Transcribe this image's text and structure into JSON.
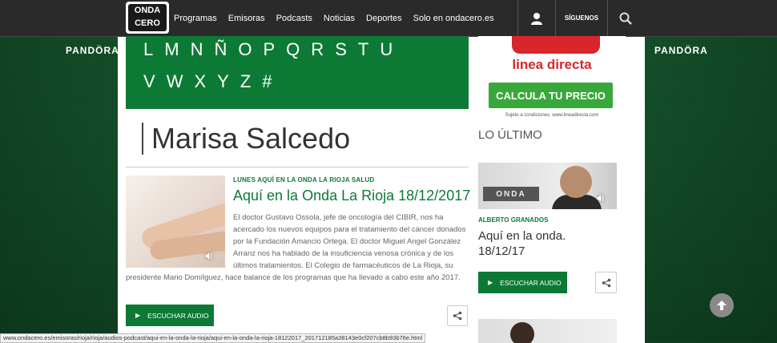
{
  "brand": {
    "logo_line1": "ONDA",
    "logo_line2": "CERO",
    "sponsor_left": "PANDÖRA",
    "sponsor_right": "PANDÖRA"
  },
  "nav": {
    "items": [
      "Programas",
      "Emisoras",
      "Podcasts",
      "Noticias",
      "Deportes",
      "Solo en ondacero.es"
    ],
    "follow_label": "SÍGUENOS",
    "user_icon": "user-icon",
    "search_icon": "search-icon"
  },
  "alphabet": {
    "row1": [
      "L",
      "M",
      "N",
      "Ñ",
      "O",
      "P",
      "Q",
      "R",
      "S",
      "T",
      "U"
    ],
    "row2": [
      "V",
      "W",
      "X",
      "Y",
      "Z",
      "#"
    ]
  },
  "page": {
    "title": "Marisa Salcedo"
  },
  "article": {
    "category": "LUNES AQUÍ EN LA ONDA LA RIOJA SALUD",
    "title": "Aquí en la Onda La Rioja 18/12/2017",
    "text": "El doctor Gustavo Ossola, jefe de oncología del CIBIR, nos ha acercado los nuevos equipos para el tratamiento del cáncer donados por la Fundación Amancio Ortega. El doctor Miguel Angel González Arranz nos ha hablado de la insuficiencia venosa crónica y de los últimos tratamientos. El Colegio de farmacéuticos de La Rioja, su presidente Mario Domílguez, hace balance de los programas que ha llevado a cabo este año 2017.",
    "listen_label": "ESCUCHAR AUDIO"
  },
  "ad": {
    "brand": "linea directa",
    "cta": "CALCULA TU PRECIO",
    "fine_print": "Sujeto a condiciones. www.lineadirecta.com"
  },
  "sidebar": {
    "heading": "LO ÚLTIMO",
    "thumb_sign": "ONDA",
    "item": {
      "category": "ALBERTO GRANADOS",
      "title": "Aquí en la onda. 18/12/17",
      "listen_label": "ESCUCHAR AUDIO"
    }
  },
  "status_url": "www.ondacero.es/emisoras/rioja/rioja/audios-podcast/aqui-en-la-onda-la-rioja/aqui-en-la-onda-la-rioja-18122017_201712185a38143e0cf207cb8b93b76e.html",
  "colors": {
    "brand_green": "#0c7a35",
    "ad_red": "#d8262c",
    "ad_cta_green": "#39a83a",
    "topbar": "#2a2a2a"
  }
}
